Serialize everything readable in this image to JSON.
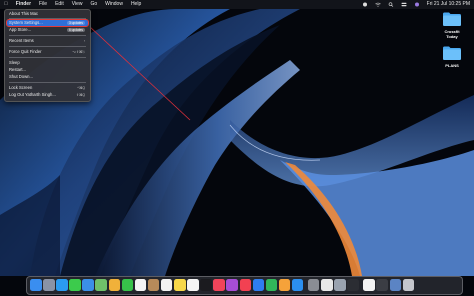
{
  "menubar": {
    "apple": "",
    "items": [
      "Finder",
      "File",
      "Edit",
      "View",
      "Go",
      "Window",
      "Help"
    ],
    "clock": "Fri 21 Jul  10:25 PM"
  },
  "apple_menu": {
    "items": [
      {
        "label": "About This Mac"
      },
      {
        "label": "System Settings...",
        "badge": "3 updates",
        "active": true
      },
      {
        "label": "App Store...",
        "badge": "6 updates"
      },
      {
        "label": "Recent Items",
        "shortcut": "›"
      },
      {
        "label": "Force Quit Finder",
        "shortcut": "⌥⇧⌘⎋"
      },
      {
        "label": "Sleep"
      },
      {
        "label": "Restart..."
      },
      {
        "label": "Shut Down..."
      },
      {
        "label": "Lock Screen",
        "shortcut": "^⌘Q"
      },
      {
        "label": "Log Out Yatharth Singh...",
        "shortcut": "⇧⌘Q"
      }
    ]
  },
  "desktop": {
    "folders": [
      {
        "label": "Crossfit Today"
      },
      {
        "label": "PLANS"
      }
    ]
  },
  "dock": {
    "apps": [
      {
        "icon": "finder-icon",
        "color": "#3a8ef0"
      },
      {
        "icon": "launchpad-icon",
        "color": "#8a93a6"
      },
      {
        "icon": "safari-icon",
        "color": "#2b9bf0"
      },
      {
        "icon": "messages-icon",
        "color": "#3ccb4c"
      },
      {
        "icon": "mail-icon",
        "color": "#3b8fe8"
      },
      {
        "icon": "maps-icon",
        "color": "#6fc06a"
      },
      {
        "icon": "photos-icon",
        "color": "#f0b13a"
      },
      {
        "icon": "facetime-icon",
        "color": "#37c24a"
      },
      {
        "icon": "calendar-icon",
        "color": "#f4f4f4"
      },
      {
        "icon": "contacts-icon",
        "color": "#b78a5a"
      },
      {
        "icon": "reminders-icon",
        "color": "#f2f2f2"
      },
      {
        "icon": "notes-icon",
        "color": "#f7d84a"
      },
      {
        "icon": "freeform-icon",
        "color": "#f5f5f5"
      },
      {
        "icon": "tv-icon",
        "color": "#1b1b1f"
      },
      {
        "icon": "music-icon",
        "color": "#f0445a"
      },
      {
        "icon": "podcasts-icon",
        "color": "#a64ed6"
      },
      {
        "icon": "news-icon",
        "color": "#f24152"
      },
      {
        "icon": "keynote-icon",
        "color": "#2f7df0"
      },
      {
        "icon": "numbers-icon",
        "color": "#31b75a"
      },
      {
        "icon": "pages-icon",
        "color": "#f5a23a"
      },
      {
        "icon": "app-store-icon",
        "color": "#2b8ff0"
      },
      {
        "icon": "system-settings-icon",
        "color": "#8a8d94"
      },
      {
        "icon": "chrome-icon",
        "color": "#e8e8e8"
      },
      {
        "icon": "preview-icon",
        "color": "#9aa3b0"
      },
      {
        "icon": "activity-monitor-icon",
        "color": "#2b2d33"
      },
      {
        "icon": "document-icon",
        "color": "#f4f4f4"
      },
      {
        "icon": "screenshot-icon",
        "color": "#3b3d44"
      },
      {
        "icon": "finder-window-icon",
        "color": "#5b84c4"
      },
      {
        "icon": "trash-icon",
        "color": "#c4c6cc"
      }
    ]
  }
}
